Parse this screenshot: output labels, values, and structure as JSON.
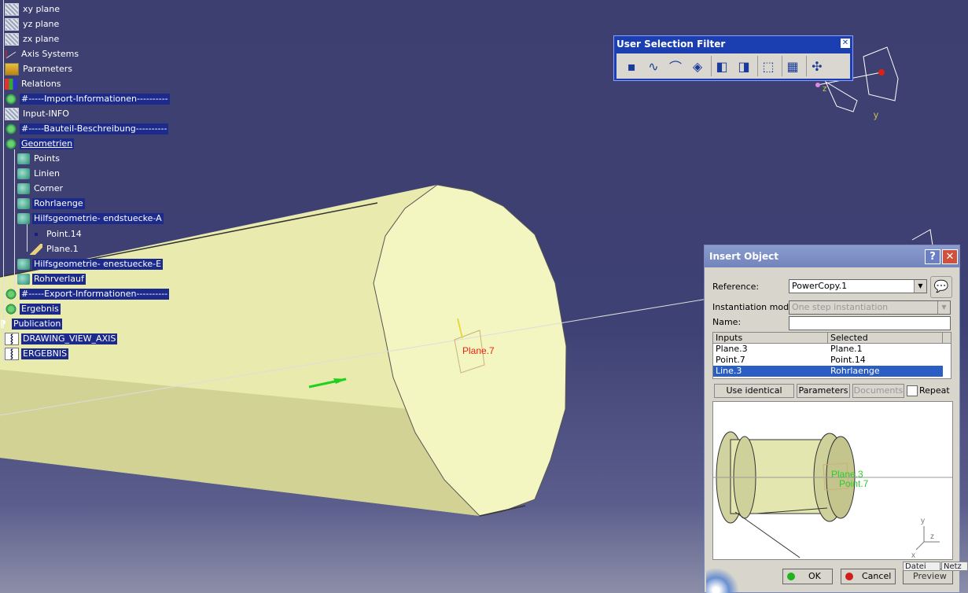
{
  "tree": {
    "items": [
      {
        "label": "xy plane",
        "icon": "plane-icon"
      },
      {
        "label": "yz plane",
        "icon": "plane-icon"
      },
      {
        "label": "zx plane",
        "icon": "plane-icon"
      },
      {
        "label": "Axis Systems",
        "icon": "axis-system-icon"
      },
      {
        "label": "Parameters",
        "icon": "parameters-icon"
      },
      {
        "label": "Relations",
        "icon": "relations-icon"
      },
      {
        "label": "#-----Import-Informationen----------",
        "icon": "geometrical-set-icon"
      },
      {
        "label": "Input-INFO",
        "icon": "plane-icon"
      },
      {
        "label": "#-----Bauteil-Beschreibung----------",
        "icon": "geometrical-set-icon"
      },
      {
        "label": "Geometrien",
        "icon": "geometrical-set-icon"
      },
      {
        "label": "Points",
        "icon": "body-icon"
      },
      {
        "label": "Linien",
        "icon": "body-icon"
      },
      {
        "label": "Corner",
        "icon": "body-icon"
      },
      {
        "label": "Rohrlaenge",
        "icon": "body-icon"
      },
      {
        "label": "Hilfsgeometrie- endstuecke-A",
        "icon": "body-icon"
      },
      {
        "label": "Point.14",
        "icon": "point-icon"
      },
      {
        "label": "Plane.1",
        "icon": "plane-feature-icon"
      },
      {
        "label": "Hilfsgeometrie- enestuecke-E",
        "icon": "body-icon"
      },
      {
        "label": "Rohrverlauf",
        "icon": "body-icon"
      },
      {
        "label": "#-----Export-Informationen----------",
        "icon": "geometrical-set-icon"
      },
      {
        "label": "Ergebnis",
        "icon": "gear-icon"
      },
      {
        "label": "Publication",
        "icon": "publication-icon"
      },
      {
        "label": "DRAWING_VIEW_AXIS",
        "icon": "published-element-icon"
      },
      {
        "label": "ERGEBNIS",
        "icon": "published-element-icon"
      }
    ]
  },
  "viewport": {
    "plane_label": "Plane.7",
    "compass_y_label": "y",
    "compass_z_label": "z"
  },
  "selection_filter": {
    "title": "User Selection Filter",
    "buttons": [
      "point-filter-icon",
      "curve-filter-icon",
      "surface-filter-icon",
      "volume-filter-icon",
      "feature-filter-icon",
      "geometrical-element-filter-icon",
      "trap-selection-icon",
      "inside-trap-icon",
      "quick-select-icon"
    ]
  },
  "dialog": {
    "title": "Insert Object",
    "reference_label": "Reference:",
    "reference_value": "PowerCopy.1",
    "instantiation_label": "Instantiation mode:",
    "instantiation_value": "One step instantiation",
    "name_label": "Name:",
    "name_value": "",
    "table": {
      "headers": [
        "Inputs",
        "Selected"
      ],
      "rows": [
        {
          "input": "Plane.3",
          "selected": "Plane.1"
        },
        {
          "input": "Point.7",
          "selected": "Point.14"
        },
        {
          "input": "Line.3",
          "selected": "Rohrlaenge"
        }
      ]
    },
    "buttons": {
      "use_identical": "Use identical name",
      "parameters": "Parameters",
      "documents": "Documents",
      "repeat": "Repeat",
      "ok": "OK",
      "cancel": "Cancel",
      "preview": "Preview"
    },
    "preview_labels": {
      "plane": "Plane.3",
      "point": "Point.7",
      "y": "y",
      "z": "z",
      "x": "x"
    }
  },
  "statusbar": {
    "datei": "Datei",
    "netz": "Netz"
  },
  "colors": {
    "background": "#3e4174",
    "cylinder": "#eef0b8",
    "accent": "#2b5ec4"
  }
}
